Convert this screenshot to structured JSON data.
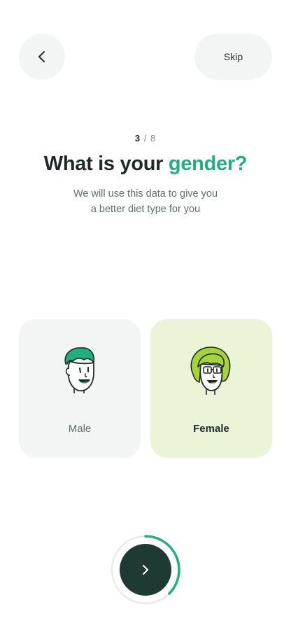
{
  "header": {
    "back_icon": "chevron-left-icon",
    "skip_label": "Skip"
  },
  "step": {
    "current": "3",
    "separator": "/",
    "total": "8"
  },
  "title": {
    "prefix": "What is your ",
    "highlight": "gender?"
  },
  "subtitle": {
    "line1": "We will use this data to give you",
    "line2": "a better diet type for you"
  },
  "options": [
    {
      "label": "Male",
      "icon": "male-face-icon",
      "selected": false
    },
    {
      "label": "Female",
      "icon": "female-face-icon",
      "selected": true
    }
  ],
  "progress": {
    "fraction": 0.375,
    "next_icon": "chevron-right-icon"
  },
  "colors": {
    "accent": "#20b07f",
    "dark": "#1f3a34",
    "selected_card": "#ebf4d7",
    "card": "#f3f5f4"
  }
}
